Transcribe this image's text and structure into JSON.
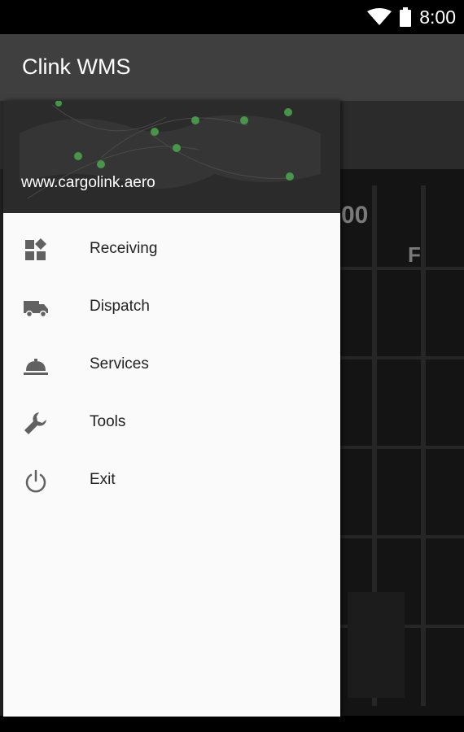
{
  "status_bar": {
    "time": "8:00"
  },
  "app_bar": {
    "title": "Clink WMS"
  },
  "drawer": {
    "header_url": "www.cargolink.aero",
    "items": [
      {
        "label": "Receiving",
        "icon": "receiving-icon"
      },
      {
        "label": "Dispatch",
        "icon": "truck-icon"
      },
      {
        "label": "Services",
        "icon": "room-service-icon"
      },
      {
        "label": "Tools",
        "icon": "wrench-icon"
      },
      {
        "label": "Exit",
        "icon": "power-icon"
      }
    ]
  },
  "background": {
    "sign_top": "00",
    "sign_side": "F"
  },
  "colors": {
    "app_bar": "#3f3f3f",
    "drawer": "#fafafa",
    "icon": "#616161",
    "map_dots": "#4caf50"
  }
}
